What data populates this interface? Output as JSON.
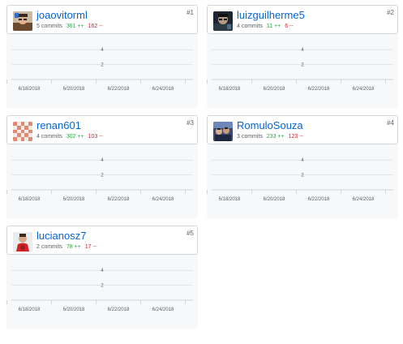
{
  "contributors": [
    {
      "username": "joaovitorml",
      "rank": "#1",
      "commits": "5 commits",
      "additions": "361 ++",
      "deletions": "162 --",
      "avatar_icon": "avatar-photo-glasses-icon",
      "chart_data": {
        "type": "area",
        "x_ticks": [
          "6/18/2018",
          "6/20/2018",
          "6/22/2018",
          "6/24/2018"
        ],
        "y_ticks": [
          "4",
          "2"
        ],
        "ylim": [
          0,
          5
        ],
        "xlabel": "",
        "ylabel": "",
        "grid": true
      }
    },
    {
      "username": "luizguilherme5",
      "rank": "#2",
      "commits": "4 commits",
      "additions": "11 ++",
      "deletions": "6 --",
      "avatar_icon": "avatar-photo-dark-icon",
      "chart_data": {
        "type": "area",
        "x_ticks": [
          "6/18/2018",
          "6/20/2018",
          "6/22/2018",
          "6/24/2018"
        ],
        "y_ticks": [
          "4",
          "2"
        ],
        "ylim": [
          0,
          5
        ],
        "xlabel": "",
        "ylabel": "",
        "grid": true
      }
    },
    {
      "username": "renan601",
      "rank": "#3",
      "commits": "4 commits",
      "additions": "302 ++",
      "deletions": "103 --",
      "avatar_icon": "avatar-identicon-salmon-icon",
      "chart_data": {
        "type": "area",
        "x_ticks": [
          "6/18/2018",
          "6/20/2018",
          "6/22/2018",
          "6/24/2018"
        ],
        "y_ticks": [
          "4",
          "2"
        ],
        "ylim": [
          0,
          5
        ],
        "xlabel": "",
        "ylabel": "",
        "grid": true
      }
    },
    {
      "username": "RomuloSouza",
      "rank": "#4",
      "commits": "3 commits",
      "additions": "233 ++",
      "deletions": "123 --",
      "avatar_icon": "avatar-photo-group-icon",
      "chart_data": {
        "type": "area",
        "x_ticks": [
          "6/18/2018",
          "6/20/2018",
          "6/22/2018",
          "6/24/2018"
        ],
        "y_ticks": [
          "4",
          "2"
        ],
        "ylim": [
          0,
          5
        ],
        "xlabel": "",
        "ylabel": "",
        "grid": true
      }
    },
    {
      "username": "lucianosz7",
      "rank": "#5",
      "commits": "2 commits",
      "additions": "78 ++",
      "deletions": "17 --",
      "avatar_icon": "avatar-photo-red-shirt-icon",
      "chart_data": {
        "type": "area",
        "x_ticks": [
          "6/18/2018",
          "6/20/2018",
          "6/22/2018",
          "6/24/2018"
        ],
        "y_ticks": [
          "4",
          "2"
        ],
        "ylim": [
          0,
          5
        ],
        "xlabel": "",
        "ylabel": "",
        "grid": true
      }
    }
  ]
}
